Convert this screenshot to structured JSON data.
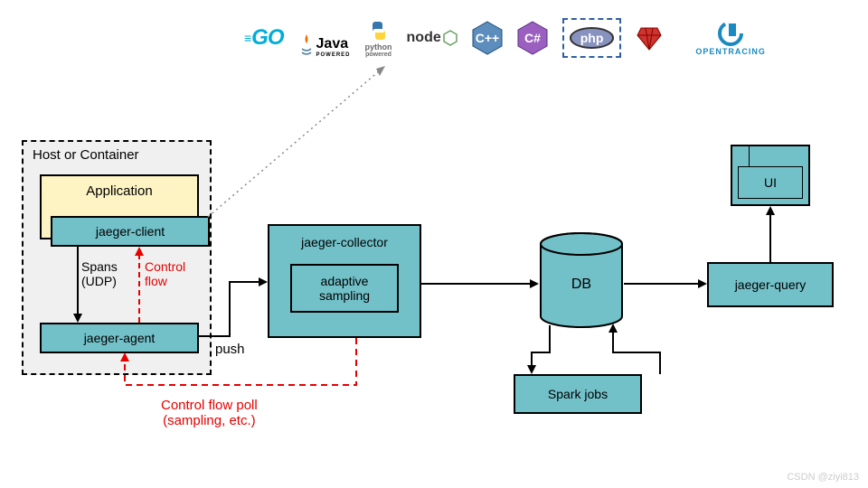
{
  "languages": {
    "go": "GO",
    "java": "Java",
    "java_sub": "POWERED",
    "python": "python",
    "python_sub": "powered",
    "node": "node",
    "cpp": "C++",
    "csharp": "C#",
    "php": "php",
    "ruby": "◆",
    "opentracing": "OPENTRACING"
  },
  "container": {
    "title": "Host or Container",
    "application": "Application",
    "client": "jaeger-client",
    "agent": "jaeger-agent",
    "spans_label": "Spans\n(UDP)",
    "control_flow": "Control\nflow"
  },
  "collector": {
    "title": "jaeger-collector",
    "sampling": "adaptive\nsampling"
  },
  "push_label": "push",
  "db": "DB",
  "spark": "Spark jobs",
  "query": "jaeger-query",
  "ui": "UI",
  "control_poll": "Control flow poll\n(sampling, etc.)",
  "watermark": "CSDN @ziyi813"
}
